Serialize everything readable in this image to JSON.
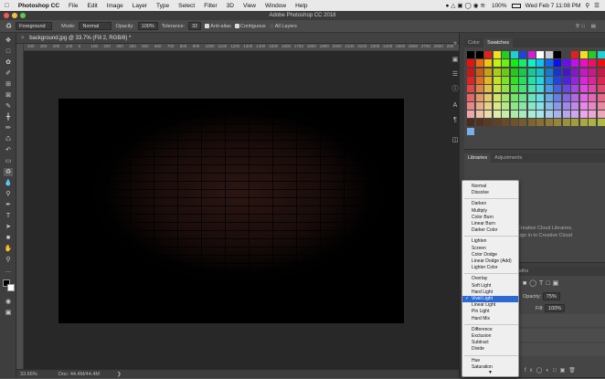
{
  "menubar": {
    "app": "Photoshop CC",
    "items": [
      "File",
      "Edit",
      "Image",
      "Layer",
      "Type",
      "Select",
      "Filter",
      "3D",
      "View",
      "Window",
      "Help"
    ],
    "battery": "100%",
    "clock": "Wed Feb 7  11:08 PM"
  },
  "window": {
    "title": "Adobe Photoshop CC 2018"
  },
  "options": {
    "fill_source": "Foreground",
    "mode_label": "Mode:",
    "mode_value": "Normal",
    "opacity_label": "Opacity:",
    "opacity_value": "100%",
    "tolerance_label": "Tolerance:",
    "tolerance_value": "32",
    "antialias_label": "Anti-alias",
    "contiguous_label": "Contiguous",
    "all_layers_label": "All Layers"
  },
  "document": {
    "tab_title": "background.jpg @ 33.7% (Fill 2, RGB/8) *",
    "ruler_ticks": [
      "400",
      "300",
      "200",
      "100",
      "0",
      "100",
      "200",
      "300",
      "400",
      "500",
      "600",
      "700",
      "800",
      "900",
      "1000",
      "1100",
      "1200",
      "1300",
      "1400",
      "1500",
      "1600",
      "1700",
      "1800",
      "1900",
      "2000",
      "2100",
      "2200",
      "2300",
      "2400",
      "2500",
      "2600",
      "2700",
      "2800",
      "290"
    ],
    "zoom": "33.66%",
    "doc_size": "Doc: 44.4M/44.4M"
  },
  "panels": {
    "color_tabs": [
      "Color",
      "Swatches"
    ],
    "libraries_tabs": [
      "Libraries",
      "Adjustments"
    ],
    "libraries_msg_1": "Creative Cloud Libraries,",
    "libraries_msg_2": "sign in to Creative Cloud",
    "layers_tab_fragment": "Paths",
    "opacity_label": "Opacity:",
    "opacity_value": "75%",
    "fill_label": "Fill:",
    "fill_value": "100%"
  },
  "blend_menu": {
    "groups": [
      [
        "Normal",
        "Dissolve"
      ],
      [
        "Darken",
        "Multiply",
        "Color Burn",
        "Linear Burn",
        "Darker Color"
      ],
      [
        "Lighten",
        "Screen",
        "Color Dodge",
        "Linear Dodge (Add)",
        "Lighter Color"
      ],
      [
        "Overlay",
        "Soft Light",
        "Hard Light",
        "Vivid Light",
        "Linear Light",
        "Pin Light",
        "Hard Mix"
      ],
      [
        "Difference",
        "Exclusion",
        "Subtract",
        "Divide"
      ],
      [
        "Hue",
        "Saturation"
      ]
    ],
    "selected": "Vivid Light"
  },
  "colors": {
    "selection_blue": "#2c69d0",
    "panel_bg": "#454545"
  }
}
